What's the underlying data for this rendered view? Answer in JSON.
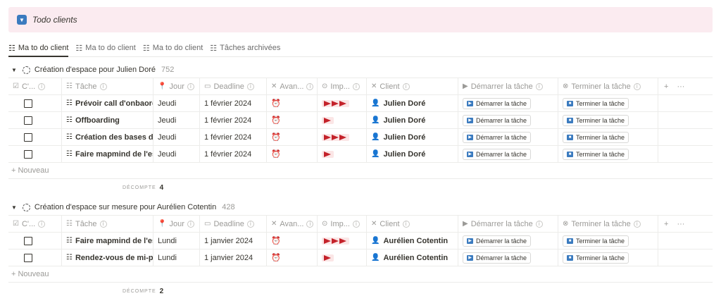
{
  "banner": {
    "title": "Todo clients"
  },
  "tabs": [
    {
      "label": "Ma to do client"
    },
    {
      "label": "Ma to do client"
    },
    {
      "label": "Ma to do client"
    },
    {
      "label": "Tâches archivées"
    }
  ],
  "columns": {
    "c": "C'...",
    "tache": "Tâche",
    "jour": "Jour",
    "deadline": "Deadline",
    "avancement": "Avan...",
    "importance": "Imp...",
    "client": "Client",
    "demarrer": "Démarrer la tâche",
    "terminer": "Terminer la tâche"
  },
  "add_label": "+ Nouveau",
  "count_label": "DÉCOMPTE",
  "button_start": "Démarrer la tâche",
  "button_end": "Terminer la tâche",
  "groups": [
    {
      "title": "Création d'espace pour Julien Doré",
      "count": "752",
      "rows": [
        {
          "task": "Prévoir call d'onbaording",
          "day": "Jeudi",
          "deadline": "1 février 2024",
          "flags": 3,
          "client": "Julien Doré"
        },
        {
          "task": "Offboarding",
          "day": "Jeudi",
          "deadline": "1 février 2024",
          "flags": 1,
          "client": "Julien Doré"
        },
        {
          "task": "Création des bases de d",
          "day": "Jeudi",
          "deadline": "1 février 2024",
          "flags": 3,
          "client": "Julien Doré"
        },
        {
          "task": "Faire mapmind de l'espa",
          "day": "Jeudi",
          "deadline": "1 février 2024",
          "flags": 1,
          "client": "Julien Doré"
        }
      ],
      "total": "4"
    },
    {
      "title": "Création d'espace sur mesure pour Aurélien Cotentin",
      "count": "428",
      "rows": [
        {
          "task": "Faire mapmind de l'espa",
          "day": "Lundi",
          "deadline": "1 janvier 2024",
          "flags": 3,
          "client": "Aurélien Cotentin"
        },
        {
          "task": "Rendez-vous de mi-pro",
          "day": "Lundi",
          "deadline": "1 janvier 2024",
          "flags": 1,
          "client": "Aurélien Cotentin"
        }
      ],
      "total": "2"
    }
  ]
}
